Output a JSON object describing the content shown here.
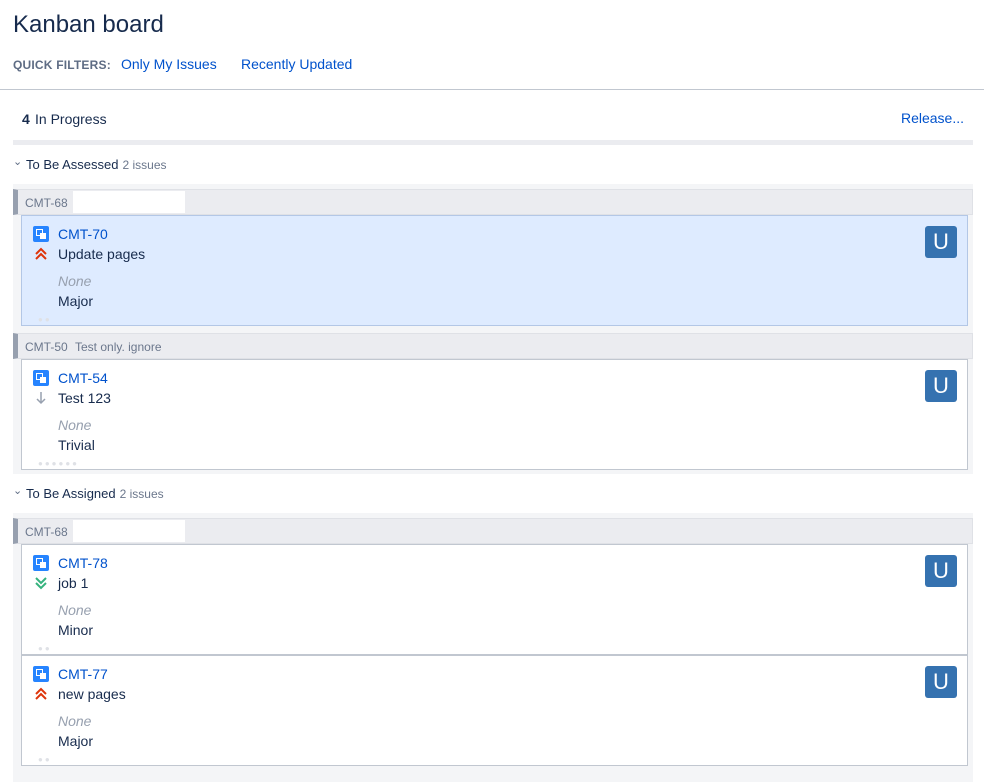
{
  "board": {
    "title": "Kanban board"
  },
  "quick_filters": {
    "label": "QUICK FILTERS:",
    "items": [
      "Only My Issues",
      "Recently Updated"
    ]
  },
  "column": {
    "count": "4",
    "name": "In Progress",
    "release_label": "Release..."
  },
  "swimlanes": [
    {
      "name": "To Be Assessed",
      "count_label": "2 issues",
      "groups": [
        {
          "parent_key": "CMT-68",
          "parent_summary": "",
          "cards": [
            {
              "key": "CMT-70",
              "summary": "Update pages",
              "field_empty": "None",
              "severity": "Major",
              "priority": "highest",
              "avatar": "U",
              "selected": true
            }
          ]
        },
        {
          "parent_key": "CMT-50",
          "parent_summary": "Test only. ignore",
          "cards": [
            {
              "key": "CMT-54",
              "summary": "Test 123",
              "field_empty": "None",
              "severity": "Trivial",
              "priority": "low",
              "avatar": "U",
              "selected": false
            }
          ]
        }
      ]
    },
    {
      "name": "To Be Assigned",
      "count_label": "2 issues",
      "groups": [
        {
          "parent_key": "CMT-68",
          "parent_summary": "",
          "cards": [
            {
              "key": "CMT-78",
              "summary": "job 1",
              "field_empty": "None",
              "severity": "Minor",
              "priority": "lowest",
              "avatar": "U",
              "selected": false
            },
            {
              "key": "CMT-77",
              "summary": "new pages",
              "field_empty": "None",
              "severity": "Major",
              "priority": "highest",
              "avatar": "U",
              "selected": false
            }
          ]
        }
      ]
    }
  ],
  "colors": {
    "link": "#0052cc",
    "selected_card": "#deebff",
    "avatar": "#3572b0",
    "priority_high": "#de350b",
    "priority_lowest": "#36b37e",
    "priority_low": "#97a0af"
  },
  "icons": {
    "issue_type": "subtask-icon",
    "lane_toggle": "chevron-down-icon"
  }
}
